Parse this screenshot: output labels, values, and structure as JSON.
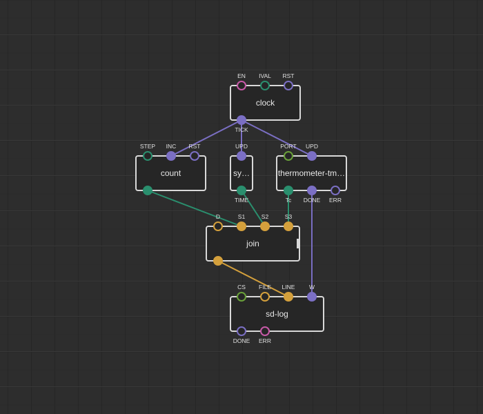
{
  "colors": {
    "background": "#2d2d2d",
    "node_fill": "#262626",
    "node_border": "#d9d9d9",
    "pin_pulse": "#7b6fc4",
    "pin_number": "#2a8f6e",
    "pin_string": "#d4a03c",
    "pin_port": "#6aa13a",
    "pin_boolean": "#c95aa9"
  },
  "nodes": {
    "clock": {
      "title": "clock",
      "inputs": [
        {
          "label": "EN",
          "type": "boolean",
          "filled": false
        },
        {
          "label": "IVAL",
          "type": "number",
          "filled": false
        },
        {
          "label": "RST",
          "type": "pulse",
          "filled": false
        }
      ],
      "outputs": [
        {
          "label": "TICK",
          "type": "pulse",
          "filled": true
        }
      ]
    },
    "count": {
      "title": "count",
      "inputs": [
        {
          "label": "STEP",
          "type": "number",
          "filled": false
        },
        {
          "label": "INC",
          "type": "pulse",
          "filled": true
        },
        {
          "label": "RST",
          "type": "pulse",
          "filled": false
        }
      ],
      "outputs": [
        {
          "label": "",
          "type": "number",
          "filled": true
        }
      ]
    },
    "sys": {
      "title": "sy…",
      "inputs": [
        {
          "label": "UPD",
          "type": "pulse",
          "filled": true
        }
      ],
      "outputs": [
        {
          "label": "TIME",
          "type": "number",
          "filled": true
        }
      ]
    },
    "thermometer": {
      "title": "thermometer-tm…",
      "inputs": [
        {
          "label": "PORT",
          "type": "port",
          "filled": false
        },
        {
          "label": "UPD",
          "type": "pulse",
          "filled": true
        }
      ],
      "outputs": [
        {
          "label": "Tc",
          "type": "number",
          "filled": true
        },
        {
          "label": "DONE",
          "type": "pulse",
          "filled": true
        },
        {
          "label": "ERR",
          "type": "pulse",
          "filled": false
        }
      ]
    },
    "join": {
      "title": "join",
      "inputs": [
        {
          "label": "D",
          "type": "string",
          "filled": false
        },
        {
          "label": "S1",
          "type": "string",
          "filled": true
        },
        {
          "label": "S2",
          "type": "string",
          "filled": true
        },
        {
          "label": "S3",
          "type": "string",
          "filled": true
        }
      ],
      "outputs": [
        {
          "label": "",
          "type": "string",
          "filled": true
        }
      ]
    },
    "sdlog": {
      "title": "sd-log",
      "inputs": [
        {
          "label": "CS",
          "type": "port",
          "filled": false
        },
        {
          "label": "FILE",
          "type": "string",
          "filled": false
        },
        {
          "label": "LINE",
          "type": "string",
          "filled": true
        },
        {
          "label": "W",
          "type": "pulse",
          "filled": true
        }
      ],
      "outputs": [
        {
          "label": "DONE",
          "type": "pulse",
          "filled": false
        },
        {
          "label": "ERR",
          "type": "boolean",
          "filled": false
        }
      ]
    }
  },
  "links": [
    {
      "from": "clock.out.0",
      "to": "count.in.1",
      "type": "pulse"
    },
    {
      "from": "clock.out.0",
      "to": "sys.in.0",
      "type": "pulse"
    },
    {
      "from": "clock.out.0",
      "to": "thermometer.in.1",
      "type": "pulse"
    },
    {
      "from": "count.out.0",
      "to": "join.in.1",
      "type": "number"
    },
    {
      "from": "sys.out.0",
      "to": "join.in.2",
      "type": "number"
    },
    {
      "from": "thermometer.out.0",
      "to": "join.in.3",
      "type": "number"
    },
    {
      "from": "thermometer.out.1",
      "to": "sdlog.in.3",
      "type": "pulse"
    },
    {
      "from": "join.out.0",
      "to": "sdlog.in.2",
      "type": "string"
    }
  ]
}
